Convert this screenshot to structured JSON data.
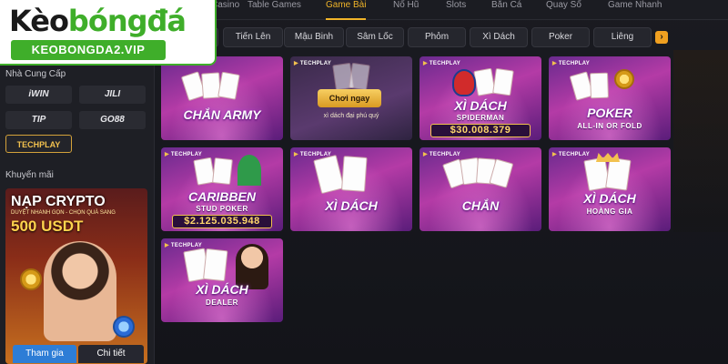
{
  "logo": {
    "brand_part1": "Kèo",
    "brand_part2": "bóngđá",
    "domain": "KEOBONGDA2.VIP"
  },
  "topnav": {
    "tabs": [
      "Casino",
      "Table Games",
      "Game Bài",
      "Nổ Hũ",
      "Slots",
      "Bắn Cá",
      "Quay Số",
      "Game Nhanh"
    ],
    "active": "Game Bài"
  },
  "sidebar": {
    "providers_title": "Nhà Cung Cấp",
    "providers": [
      "iWIN",
      "JILI",
      "TIP",
      "GO88",
      "TECHPLAY"
    ],
    "promo_title": "Khuyến mãi",
    "promo": {
      "headline": "NẠP CRYPTO",
      "tagline": "DUYỆT NHANH GỌN - CHỌN QUÀ SANG",
      "amount": "500 USDT",
      "join_label": "Tham gia",
      "detail_label": "Chi tiết"
    }
  },
  "categories": [
    "Tiến Lên",
    "Mậu Binh",
    "Sâm Lốc",
    "Phỏm",
    "Xì Dách",
    "Poker",
    "Liêng"
  ],
  "provider_tag": "TECHPLAY",
  "games": [
    {
      "title": "CHẮN ARMY",
      "subtitle": "",
      "jackpot": ""
    },
    {
      "title": "",
      "subtitle": "",
      "jackpot": "",
      "play_label": "Chơi ngay",
      "description": "xì dách đại phú quý"
    },
    {
      "title": "XÌ DÁCH",
      "subtitle": "SPIDERMAN",
      "jackpot": "$30.008.379"
    },
    {
      "title": "POKER",
      "subtitle": "ALL-IN OR FOLD",
      "jackpot": ""
    },
    {
      "title": "CARIBBEN",
      "subtitle": "STUD POKER",
      "jackpot": "$2.125.035.948"
    },
    {
      "title": "XÌ DÁCH",
      "subtitle": "",
      "jackpot": ""
    },
    {
      "title": "CHẮN",
      "subtitle": "",
      "jackpot": ""
    },
    {
      "title": "XÌ DÁCH",
      "subtitle": "HOÀNG GIA",
      "jackpot": ""
    },
    {
      "title": "XÌ DÁCH",
      "subtitle": "DEALER",
      "jackpot": ""
    }
  ],
  "colors": {
    "accent": "#f0b429",
    "brand_green": "#3fae2a",
    "card_purple": "#b43ba6"
  }
}
